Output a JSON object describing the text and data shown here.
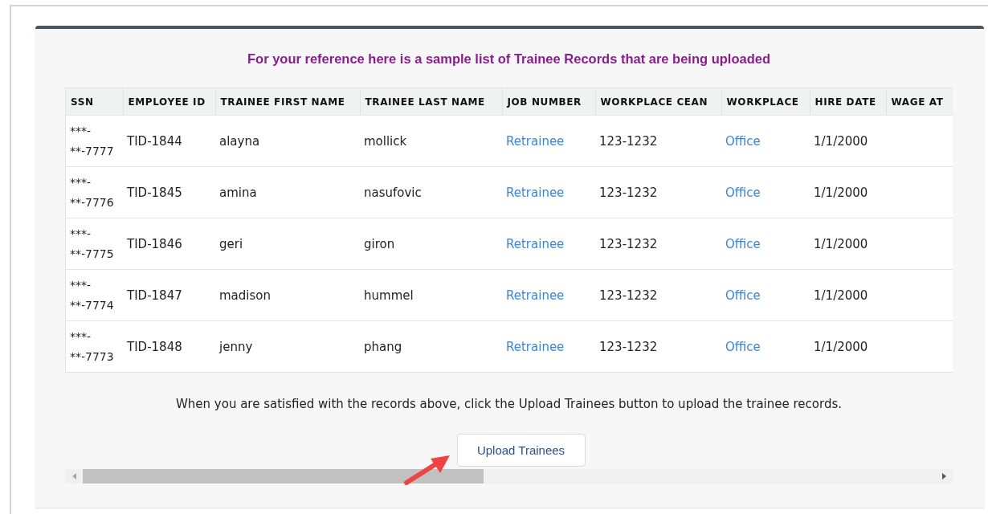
{
  "heading": "For your reference here is a sample list of Trainee Records that are being uploaded",
  "table": {
    "columns": [
      {
        "label": "SSN",
        "kind": "masked"
      },
      {
        "label": "EMPLOYEE ID",
        "kind": "text"
      },
      {
        "label": "TRAINEE FIRST NAME",
        "kind": "text"
      },
      {
        "label": "TRAINEE LAST NAME",
        "kind": "text"
      },
      {
        "label": "JOB NUMBER",
        "kind": "link"
      },
      {
        "label": "WORKPLACE CEAN",
        "kind": "text"
      },
      {
        "label": "WORKPLACE",
        "kind": "link"
      },
      {
        "label": "HIRE DATE",
        "kind": "text"
      },
      {
        "label": "WAGE AT"
      }
    ],
    "rows": [
      {
        "cells": [
          "***-\n**-7777",
          "TID-1844",
          "alayna",
          "mollick",
          "Retrainee",
          "123-1232",
          "Office",
          "1/1/2000"
        ]
      },
      {
        "cells": [
          "***-\n**-7776",
          "TID-1845",
          "amina",
          "nasufovic",
          "Retrainee",
          "123-1232",
          "Office",
          "1/1/2000"
        ]
      },
      {
        "cells": [
          "***-\n**-7775",
          "TID-1846",
          "geri",
          "giron",
          "Retrainee",
          "123-1232",
          "Office",
          "1/1/2000"
        ]
      },
      {
        "cells": [
          "***-\n**-7774",
          "TID-1847",
          "madison",
          "hummel",
          "Retrainee",
          "123-1232",
          "Office",
          "1/1/2000"
        ]
      },
      {
        "cells": [
          "***-\n**-7773",
          "TID-1848",
          "jenny",
          "phang",
          "Retrainee",
          "123-1232",
          "Office",
          "1/1/2000"
        ]
      }
    ]
  },
  "instruction": "When you are satisfied with the records above, click the Upload Trainees button to upload the trainee records.",
  "upload_button": "Upload Trainees"
}
